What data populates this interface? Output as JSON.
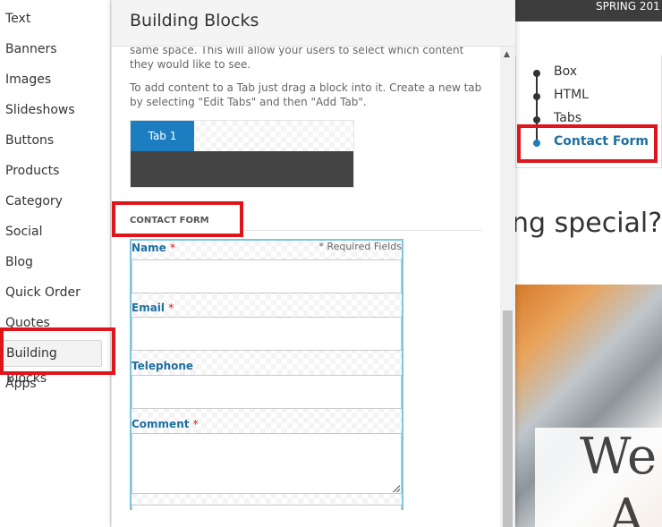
{
  "sidebar": {
    "items": [
      {
        "label": "Text"
      },
      {
        "label": "Banners"
      },
      {
        "label": "Images"
      },
      {
        "label": "Slideshows"
      },
      {
        "label": "Buttons"
      },
      {
        "label": "Products"
      },
      {
        "label": "Category"
      },
      {
        "label": "Social"
      },
      {
        "label": "Blog"
      },
      {
        "label": "Quick Order"
      },
      {
        "label": "Quotes"
      },
      {
        "label": "Building Blocks",
        "active": true
      },
      {
        "label": "Apps"
      }
    ]
  },
  "modal": {
    "title": "Building Blocks",
    "intro_tail": "same space. This will allow your users to select which content they would like to see.",
    "instructions": "To add content to a Tab just drag a block into it. Create a new tab by selecting \"Edit Tabs\" and then \"Add Tab\".",
    "tab_label": "Tab 1",
    "section_label": "CONTACT FORM",
    "form": {
      "required_note": "* Required Fields",
      "required_marker": "*",
      "fields": [
        {
          "label": "Name",
          "required": true
        },
        {
          "label": "Email",
          "required": true
        },
        {
          "label": "Telephone",
          "required": false
        },
        {
          "label": "Comment",
          "required": true
        }
      ]
    }
  },
  "preview": {
    "topbar_text": "SPRING 201",
    "nav_items": [
      {
        "label": "Box"
      },
      {
        "label": "HTML"
      },
      {
        "label": "Tabs"
      },
      {
        "label": "Contact Form",
        "active": true
      }
    ],
    "heading_fragment": "ng special?",
    "image_text_1": "We",
    "image_text_2": "A"
  },
  "colors": {
    "highlight_red": "#e0151c",
    "accent_blue": "#1c7ec0",
    "label_blue": "#1f6fa0"
  }
}
